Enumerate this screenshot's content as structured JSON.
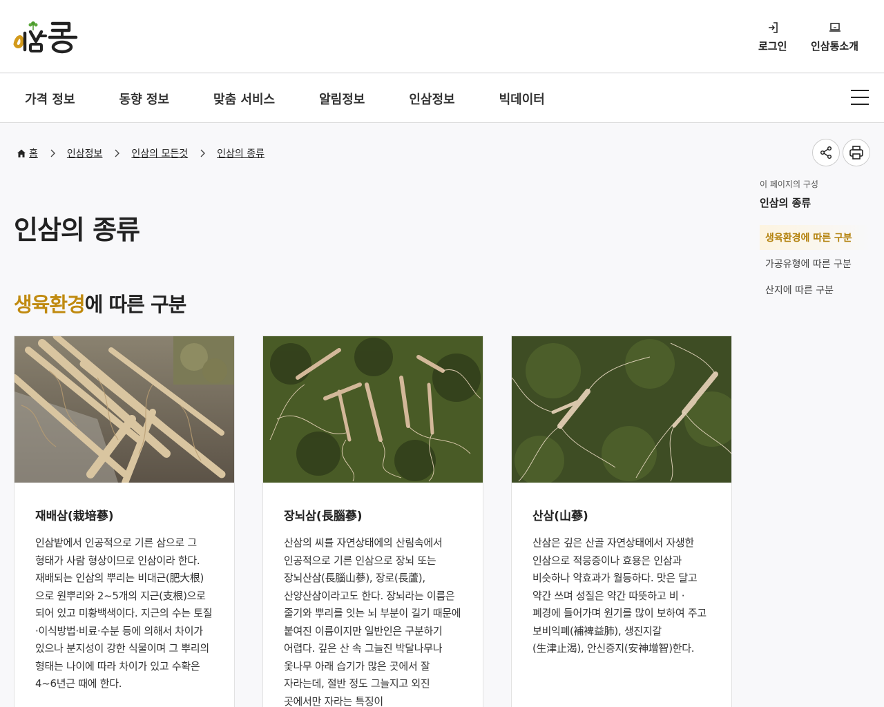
{
  "header": {
    "logo_text": "인삼통",
    "login_label": "로그인",
    "about_label": "인삼통소개"
  },
  "nav": {
    "items": [
      {
        "label": "가격 정보"
      },
      {
        "label": "동향 정보"
      },
      {
        "label": "맞춤 서비스"
      },
      {
        "label": "알림정보"
      },
      {
        "label": "인삼정보"
      },
      {
        "label": "빅데이터"
      }
    ]
  },
  "breadcrumb": {
    "home": "홈",
    "items": [
      "인삼정보",
      "인삼의 모든것",
      "인삼의 종류"
    ]
  },
  "page": {
    "title": "인삼의 종류",
    "section_accent": "생육환경",
    "section_rest": "에 따른 구분"
  },
  "toc": {
    "label": "이 페이지의 구성",
    "title": "인삼의 종류",
    "items": [
      "생육환경에 따른 구분",
      "가공유형에 따른 구분",
      "산지에 따른 구분"
    ]
  },
  "cards": [
    {
      "title": "재배삼(栽培蔘)",
      "text": "인삼밭에서 인공적으로 기른 삼으로 그 형태가 사람 형상이므로 인삼이라 한다. 재배되는 인삼의 뿌리는 비대근(肥大根)으로 원뿌리와 2~5개의 지근(支根)으로 되어 있고 미황백색이다. 지근의 수는 토질·이식방법·비료·수분 등에 의해서 차이가 있으나 분지성이 강한 식물이며 그 뿌리의 형태는 나이에 따라 차이가 있고 수확은 4~6년근 때에 한다."
    },
    {
      "title": "장뇌삼(長腦蔘)",
      "text": "산삼의 씨를 자연상태에의 산림속에서 인공적으로 기른 인삼으로 장뇌 또는 장뇌산삼(長腦山蔘), 장로(長蘆), 산양산삼이라고도 한다. 장뇌라는 이름은 줄기와 뿌리를 잇는 뇌 부분이 길기 때문에 붙여진 이름이지만 일반인은 구분하기 어렵다. 깊은 산 속 그늘진 박달나무나 옻나무 아래 습기가 많은 곳에서 잘 자라는데, 절반 정도 그늘지고 외진 곳에서만 자라는 특징이"
    },
    {
      "title": "산삼(山蔘)",
      "text": "산삼은 깊은 산골 자연상태에서 자생한 인삼으로 적응증이나 효용은 인삼과 비슷하나 약효과가 월등하다. 맛은 달고 약간 쓰며 성질은 약간 따뜻하고 비 ·폐경에 들어가며 원기를 많이 보하여 주고 보비익폐(補裨益肺), 생진지갈(生津止渴), 안신증지(安神增智)한다."
    }
  ],
  "colors": {
    "accent": "#c08a0f",
    "toc_active": "#b3810c"
  }
}
